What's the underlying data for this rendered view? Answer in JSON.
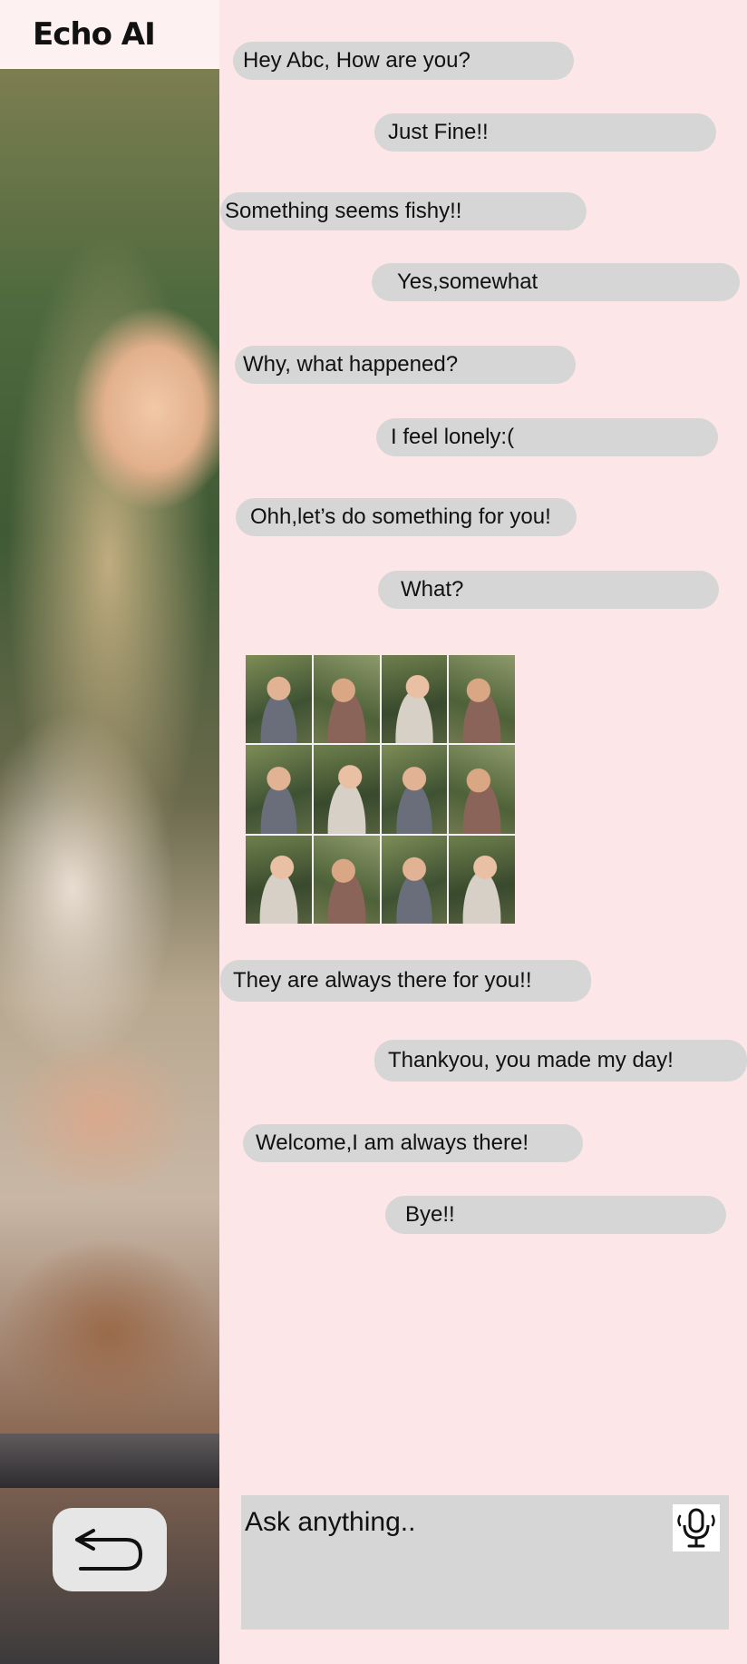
{
  "app": {
    "title": "Echo AI"
  },
  "messages": [
    {
      "sender": "ai",
      "text": "Hey Abc, How are you?"
    },
    {
      "sender": "user",
      "text": "Just Fine!!"
    },
    {
      "sender": "ai",
      "text": "Something seems fishy!!"
    },
    {
      "sender": "user",
      "text": "Yes,somewhat"
    },
    {
      "sender": "ai",
      "text": "Why, what happened?"
    },
    {
      "sender": "user",
      "text": "I feel lonely:("
    },
    {
      "sender": "ai",
      "text": "Ohh,let’s do something for you!"
    },
    {
      "sender": "user",
      "text": "What?"
    },
    {
      "sender": "ai",
      "type": "image",
      "description": "collage of people laughing together"
    },
    {
      "sender": "ai",
      "text": "They are always there for you!!"
    },
    {
      "sender": "user",
      "text": "Thankyou, you made my day!"
    },
    {
      "sender": "ai",
      "text": "Welcome,I am always there!"
    },
    {
      "sender": "user",
      "text": "Bye!!"
    }
  ],
  "composer": {
    "placeholder": "Ask anything..",
    "value": "",
    "mic_icon": "microphone-icon"
  },
  "navigation": {
    "back_icon": "back-arrow-icon"
  },
  "colors": {
    "chat_background": "#fde6e8",
    "bubble": "#d6d6d6",
    "input_background": "#d6d6d6",
    "brand_bar": "#fdf1f1"
  }
}
